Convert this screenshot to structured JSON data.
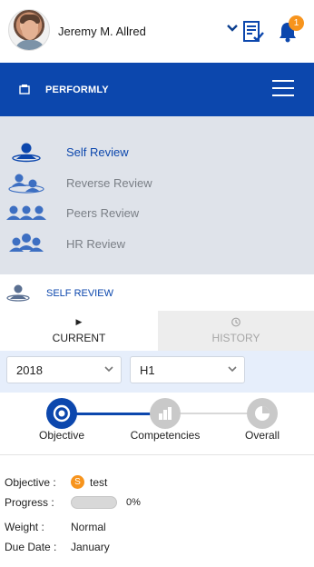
{
  "user": {
    "name": "Jeremy M. Allred",
    "notifications": "1"
  },
  "brand": {
    "name": "PERFORMLY"
  },
  "menu": {
    "items": [
      {
        "label": "Self Review",
        "active": true
      },
      {
        "label": "Reverse Review",
        "active": false
      },
      {
        "label": "Peers Review",
        "active": false
      },
      {
        "label": "HR Review",
        "active": false
      }
    ]
  },
  "section": {
    "title": "SELF REVIEW"
  },
  "tabs": {
    "current": "CURRENT",
    "history": "HISTORY"
  },
  "filters": {
    "year": "2018",
    "half": "H1"
  },
  "steps": {
    "objective": "Objective",
    "competencies": "Competencies",
    "overall": "Overall"
  },
  "details": {
    "objective_label": "Objective :",
    "objective_badge": "S",
    "objective_value": "test",
    "progress_label": "Progress :",
    "progress_value": "0%",
    "progress_fraction": 0,
    "weight_label": "Weight :",
    "weight_value": "Normal",
    "due_label": "Due Date :",
    "due_value": "January"
  },
  "colors": {
    "primary": "#0c47ad",
    "accent": "#f7941d",
    "menu_bg": "#dfe3ea",
    "inactive_text": "#7a7f86"
  }
}
